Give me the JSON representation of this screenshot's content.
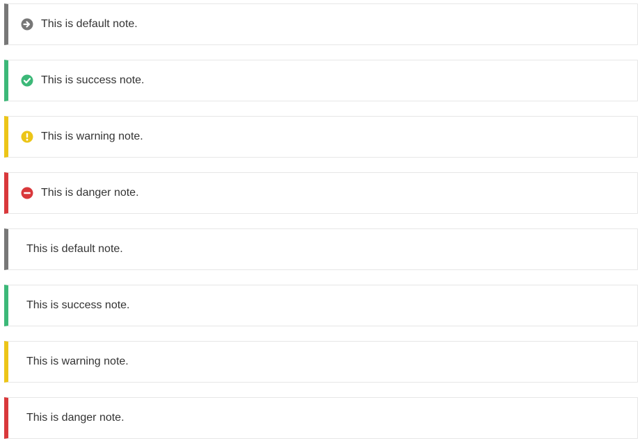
{
  "colors": {
    "default": "#777777",
    "success": "#3cb878",
    "warning": "#ecc518",
    "danger": "#d9383b",
    "border": "#e6e6e6",
    "text": "#333333"
  },
  "notes_with_icons": [
    {
      "type": "default",
      "icon": "arrow-circle-right-icon",
      "text": "This is default note."
    },
    {
      "type": "success",
      "icon": "check-circle-icon",
      "text": "This is success note."
    },
    {
      "type": "warning",
      "icon": "exclamation-circle-icon",
      "text": "This is warning note."
    },
    {
      "type": "danger",
      "icon": "minus-circle-icon",
      "text": "This is danger note."
    }
  ],
  "notes_plain": [
    {
      "type": "default",
      "text": "This is default note."
    },
    {
      "type": "success",
      "text": "This is success note."
    },
    {
      "type": "warning",
      "text": "This is warning note."
    },
    {
      "type": "danger",
      "text": "This is danger note."
    }
  ]
}
